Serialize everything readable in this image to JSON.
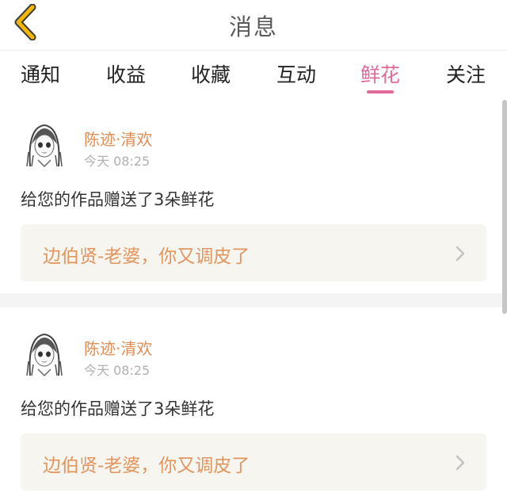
{
  "header": {
    "title": "消息",
    "back_icon": "back-chevron-icon",
    "accent_color": "#f2b705"
  },
  "tabs": [
    {
      "label": "通知",
      "active": false
    },
    {
      "label": "收益",
      "active": false
    },
    {
      "label": "收藏",
      "active": false
    },
    {
      "label": "互动",
      "active": false
    },
    {
      "label": "鲜花",
      "active": true
    },
    {
      "label": "关注",
      "active": false
    }
  ],
  "colors": {
    "active_tab": "#e06a9a",
    "username": "#e08e55",
    "work_title": "#e3955e",
    "card_bg": "#f6f5ef"
  },
  "messages": [
    {
      "username": "陈迹·清欢",
      "time": "今天 08:25",
      "text": "给您的作品赠送了3朵鲜花",
      "work_title": "边伯贤-老婆，你又调皮了"
    },
    {
      "username": "陈迹·清欢",
      "time": "今天 08:25",
      "text": "给您的作品赠送了3朵鲜花",
      "work_title": "边伯贤-老婆，你又调皮了"
    }
  ]
}
